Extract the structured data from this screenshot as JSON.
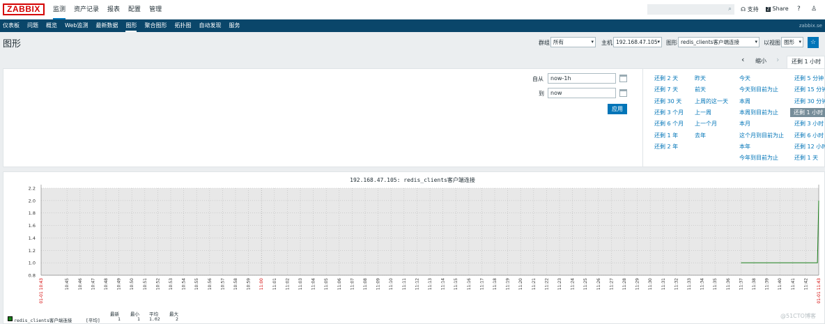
{
  "app": {
    "logo": "ZABBIX"
  },
  "top_menu": [
    {
      "label": "监测",
      "active": true
    },
    {
      "label": "资产记录"
    },
    {
      "label": "报表"
    },
    {
      "label": "配置"
    },
    {
      "label": "管理"
    }
  ],
  "top_right": {
    "support": "支持",
    "share": "Share",
    "help": "?",
    "user": "♙"
  },
  "sub_menu": [
    {
      "label": "仪表板"
    },
    {
      "label": "问题"
    },
    {
      "label": "概览"
    },
    {
      "label": "Web监测"
    },
    {
      "label": "最新数据"
    },
    {
      "label": "图形",
      "active": true
    },
    {
      "label": "聚合图形"
    },
    {
      "label": "拓扑图"
    },
    {
      "label": "自动发现"
    },
    {
      "label": "服务"
    }
  ],
  "sub_right": "zabbix.se",
  "page": {
    "title": "图形",
    "group_label": "群组",
    "group_value": "所有",
    "host_label": "主机",
    "host_value": "192.168.47.105",
    "graph_label": "图形",
    "graph_value": "redis_clients客户端连接",
    "view_label": "以视图",
    "view_value": "图形"
  },
  "nav": {
    "prev": "‹",
    "zoom_out": "缩小",
    "next": "›",
    "active_tab": "还剩 1 小时"
  },
  "filter": {
    "from_label": "自从",
    "from_value": "now-1h",
    "to_label": "到",
    "to_value": "now",
    "apply": "应用"
  },
  "quick_ranges": {
    "col1": [
      "还剩 2 天",
      "还剩 7 天",
      "还剩 30 天",
      "还剩 3 个月",
      "还剩 6 个月",
      "还剩 1 年",
      "还剩 2 年"
    ],
    "col2": [
      "昨天",
      "前天",
      "上周的这一天",
      "上一周",
      "上一个月",
      "去年"
    ],
    "col3": [
      "今天",
      "今天到目前为止",
      "本周",
      "本周到目前为止",
      "本月",
      "这个月到目前为止",
      "本年",
      "今年到目前为止"
    ],
    "col4": [
      "还剩 5 分钟",
      "还剩 15 分钟",
      "还剩 30 分钟",
      "还剩 1 小时",
      "还剩 3 小时",
      "还剩 6 小时",
      "还剩 12 小时",
      "还剩 1 天"
    ],
    "selected": "还剩 1 小时"
  },
  "chart_data": {
    "type": "line",
    "title": "192.168.47.105: redis_clients客户端连接",
    "ylim": [
      0.8,
      2.2
    ],
    "y_ticks": [
      "2.2",
      "2.0",
      "1.8",
      "1.6",
      "1.4",
      "1.2",
      "1.0",
      "0.8"
    ],
    "x_start_label": "01-01 10:43",
    "x_end_label": "01-01 11:43",
    "x_ticks": [
      "10:45",
      "10:46",
      "10:47",
      "10:48",
      "10:49",
      "10:50",
      "10:51",
      "10:52",
      "10:53",
      "10:54",
      "10:55",
      "10:56",
      "10:57",
      "10:58",
      "10:59",
      "11:00",
      "11:01",
      "11:02",
      "11:03",
      "11:04",
      "11:05",
      "11:06",
      "11:07",
      "11:08",
      "11:09",
      "11:10",
      "11:11",
      "11:12",
      "11:13",
      "11:14",
      "11:15",
      "11:16",
      "11:17",
      "11:18",
      "11:19",
      "11:20",
      "11:21",
      "11:22",
      "11:23",
      "11:24",
      "11:25",
      "11:26",
      "11:27",
      "11:28",
      "11:29",
      "11:30",
      "11:31",
      "11:32",
      "11:33",
      "11:34",
      "11:35",
      "11:36",
      "11:37",
      "11:38",
      "11:39",
      "11:40",
      "11:41",
      "11:42"
    ],
    "series": [
      {
        "name": "redis_clients客户端连接",
        "color": "#1a7f1a",
        "x": [
          "11:37",
          "11:38",
          "11:39",
          "11:40",
          "11:41",
          "11:42",
          "11:43"
        ],
        "values": [
          1,
          1,
          1,
          1,
          1,
          1,
          2
        ]
      }
    ],
    "legend": {
      "headers": [
        "最新",
        "最小",
        "平均",
        "最大"
      ],
      "row": {
        "name": "redis_clients客户端连接",
        "func": "[平均]",
        "last": "1",
        "min": "1",
        "avg": "1.02",
        "max": "2"
      }
    }
  },
  "watermark": "@51CTO博客"
}
